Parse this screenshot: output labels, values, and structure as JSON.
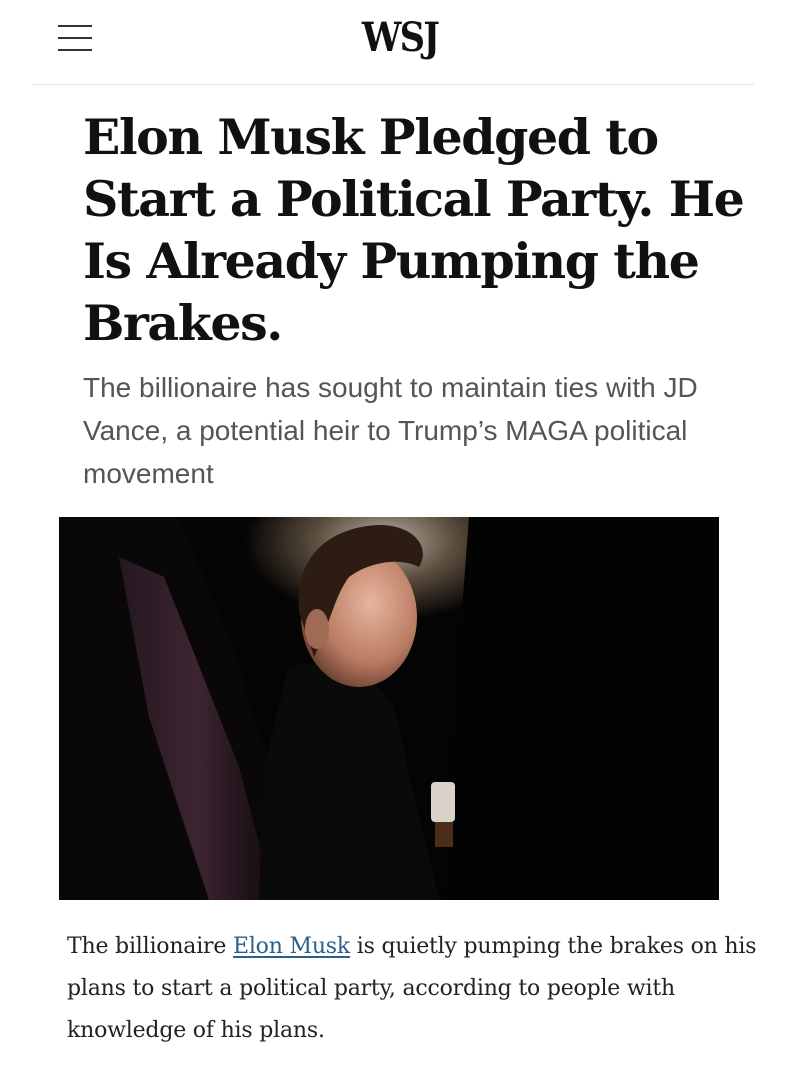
{
  "header": {
    "logo": "WSJ",
    "menu_icon": "hamburger-menu-icon"
  },
  "article": {
    "headline": "Elon Musk Pledged to Start a Political Party. He Is Already Pumping the Brakes.",
    "dek": "The billionaire has sought to maintain ties with JD Vance, a potential heir to Trump’s MAGA political movement",
    "photo_subject": "elon-musk-photo",
    "body": {
      "before_link": "The billionaire ",
      "link_text": "Elon Musk",
      "after_link": " is quietly pumping the brakes on his plans to start a political party, according to people with knowledge of his plans."
    }
  },
  "colors": {
    "link": "#2b5f8a",
    "headline": "#111111",
    "dek": "#555555"
  }
}
